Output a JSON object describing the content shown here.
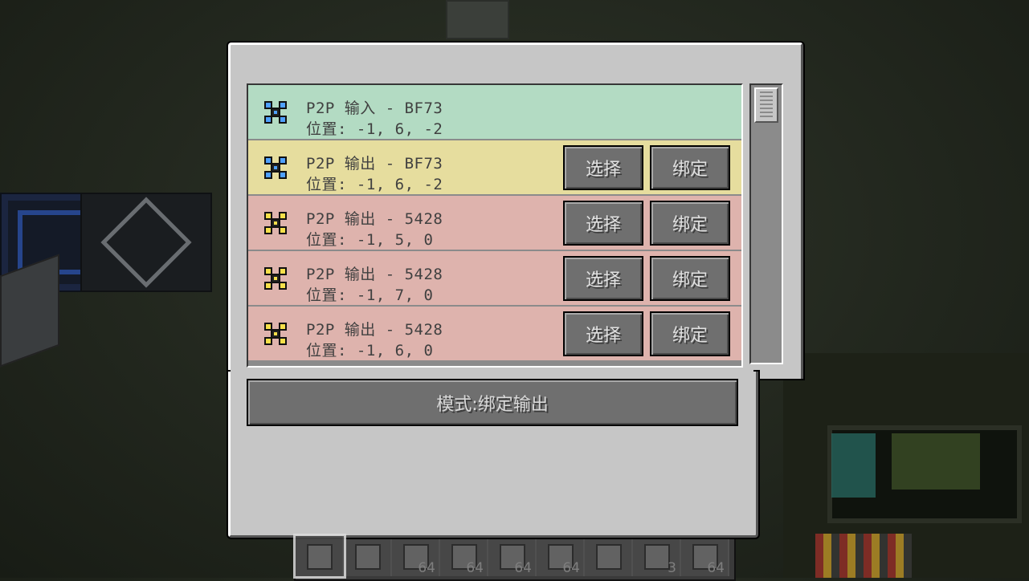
{
  "colors": {
    "input_row": "#b3dbc3",
    "selected_row": "#e6dd9e",
    "output_row": "#deb3ad",
    "icon_input": "#4fa0ff",
    "icon_output": "#f5e04a"
  },
  "hotbar": {
    "slots": [
      {
        "count": "",
        "icon": "p2p-tuner-icon"
      },
      {
        "count": "",
        "icon": "frame-icon"
      },
      {
        "count": "64",
        "icon": "block-icon"
      },
      {
        "count": "64",
        "icon": "block-icon"
      },
      {
        "count": "64",
        "icon": "block-icon"
      },
      {
        "count": "64",
        "icon": "block-icon"
      },
      {
        "count": "",
        "icon": "wrench-icon"
      },
      {
        "count": "3",
        "icon": "block-icon"
      },
      {
        "count": "64",
        "icon": "block-icon"
      }
    ]
  },
  "p2p_list": {
    "rows": [
      {
        "type": "input",
        "title": "P2P 输入 - BF73",
        "position": "位置: -1, 6, -2",
        "buttons": false
      },
      {
        "type": "output",
        "title": "P2P 输出 - BF73",
        "position": "位置: -1, 6, -2",
        "buttons": true,
        "selected": true
      },
      {
        "type": "output",
        "title": "P2P 输出 - 5428",
        "position": "位置: -1, 5, 0",
        "buttons": true
      },
      {
        "type": "output",
        "title": "P2P 输出 - 5428",
        "position": "位置: -1, 7, 0",
        "buttons": true
      },
      {
        "type": "output",
        "title": "P2P 输出 - 5428",
        "position": "位置: -1, 6, 0",
        "buttons": true
      }
    ],
    "select_label": "选择",
    "bind_label": "绑定"
  },
  "mode_button": {
    "label": "模式:绑定输出"
  }
}
